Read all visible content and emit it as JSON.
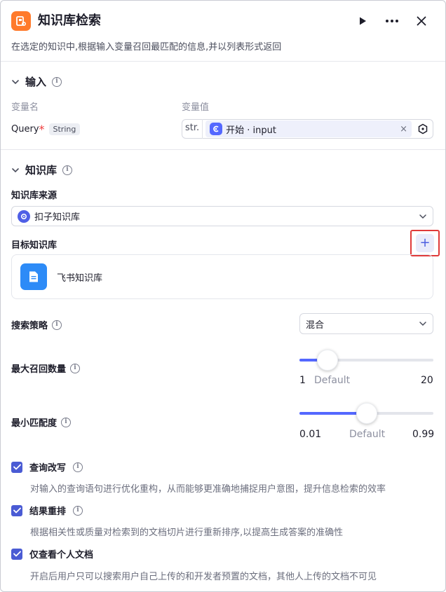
{
  "header": {
    "title": "知识库检索",
    "description": "在选定的知识中,根据输入变量召回最匹配的信息,并以列表形式返回"
  },
  "input_section": {
    "title": "输入",
    "col_name": "变量名",
    "col_value": "变量值",
    "var_name": "Query",
    "required_mark": "*",
    "var_type": "String",
    "value_prefix": "str.",
    "ref_text": "开始 · input",
    "clear_glyph": "×"
  },
  "kb_section": {
    "title": "知识库",
    "source_label": "知识库来源",
    "source_value": "扣子知识库",
    "target_label": "目标知识库",
    "add_glyph": "+",
    "kb_item": "飞书知识库"
  },
  "search": {
    "strategy_label": "搜索策略",
    "strategy_value": "混合",
    "max_label": "最大召回数量",
    "max_min": "1",
    "max_default": "Default",
    "max_max": "20",
    "max_level_fraction": 0.21,
    "min_label": "最小匹配度",
    "min_min": "0.01",
    "min_default": "Default",
    "min_max": "0.99",
    "min_level_fraction": 0.5
  },
  "options": [
    {
      "label": "查询改写",
      "desc": "对输入的查询语句进行优化重构，从而能够更准确地捕捉用户意图，提升信息检索的效率",
      "checked": true
    },
    {
      "label": "结果重排",
      "desc": "根据相关性或质量对检索到的文档切片进行重新排序,以提高生成答案的准确性",
      "checked": true
    },
    {
      "label": "仅查看个人文档",
      "desc": "开启后用户只可以搜索用户自己上传的和开发者预置的文档，其他人上传的文档不可见",
      "checked": true
    }
  ],
  "colors": {
    "accent": "#5468ff",
    "header_icon": "#ff7a2b",
    "doc_icon": "#2d8bf7",
    "highlight_border": "#e03a3a"
  }
}
